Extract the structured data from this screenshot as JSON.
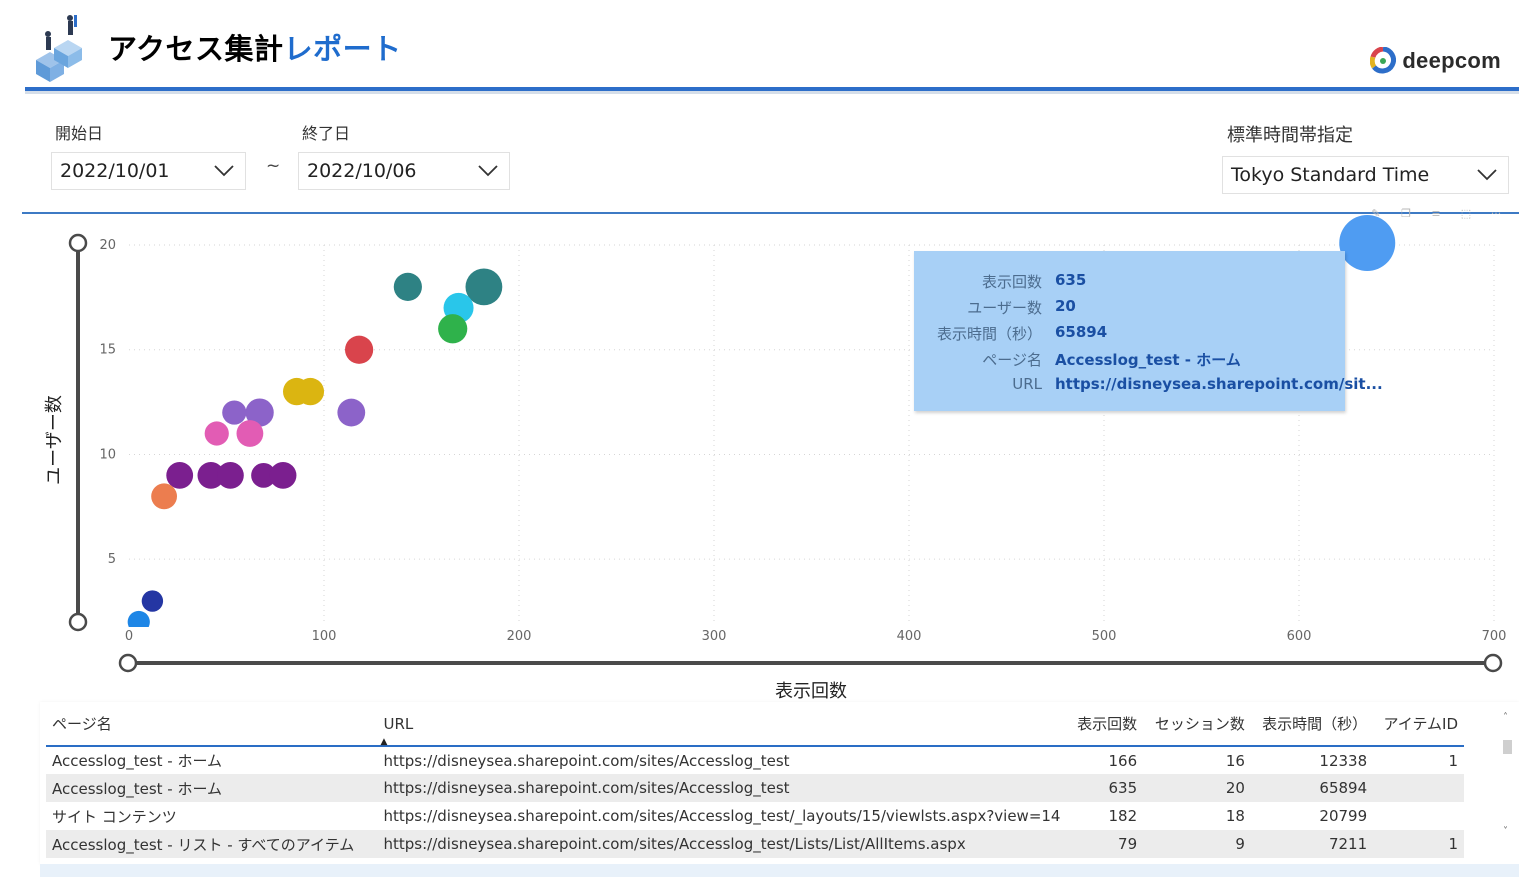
{
  "header": {
    "title_main": "アクセス集計",
    "title_accent": "レポート",
    "brand_name": "deepcom",
    "colors": {
      "accent": "#1f6ccd",
      "rule": "#2d6ec9"
    }
  },
  "filters": {
    "start_label": "開始日",
    "start_value": "2022/10/01",
    "separator": "~",
    "end_label": "終了日",
    "end_value": "2022/10/06",
    "tz_label": "標準時間帯指定",
    "tz_value": "Tokyo Standard Time"
  },
  "visual_icons": [
    "pin-icon",
    "copy-icon",
    "filter-icon",
    "focus-mode-icon",
    "more-options-icon"
  ],
  "chart_data": {
    "type": "scatter",
    "xlabel": "表示回数",
    "ylabel": "ユーザー数",
    "xlim": [
      0,
      700
    ],
    "ylim": [
      2,
      20
    ],
    "x_ticks": [
      0,
      100,
      200,
      300,
      400,
      500,
      600,
      700
    ],
    "y_ticks": [
      5,
      10,
      15,
      20
    ],
    "grid": true,
    "size_measure": "表示時間（秒）",
    "points": [
      {
        "x": 635,
        "y": 20,
        "size": 65894,
        "color": "#4f9cf2"
      },
      {
        "x": 182,
        "y": 18,
        "size": 20799,
        "color": "#2e8284"
      },
      {
        "x": 143,
        "y": 18,
        "size": 9000,
        "color": "#2e8284"
      },
      {
        "x": 169,
        "y": 17,
        "size": 11000,
        "color": "#29c6ea"
      },
      {
        "x": 166,
        "y": 16,
        "size": 10000,
        "color": "#2fb24b"
      },
      {
        "x": 118,
        "y": 15,
        "size": 9000,
        "color": "#d9444c"
      },
      {
        "x": 86,
        "y": 13,
        "size": 8000,
        "color": "#dbb511"
      },
      {
        "x": 93,
        "y": 13,
        "size": 8000,
        "color": "#dbb511"
      },
      {
        "x": 114,
        "y": 12,
        "size": 8500,
        "color": "#8c63c9"
      },
      {
        "x": 54,
        "y": 12,
        "size": 5000,
        "color": "#8c63c9"
      },
      {
        "x": 67,
        "y": 12,
        "size": 9000,
        "color": "#8c63c9"
      },
      {
        "x": 45,
        "y": 11,
        "size": 5000,
        "color": "#e25cb4"
      },
      {
        "x": 62,
        "y": 11,
        "size": 7500,
        "color": "#e25cb4"
      },
      {
        "x": 26,
        "y": 9,
        "size": 7500,
        "color": "#7b1f8f"
      },
      {
        "x": 42,
        "y": 9,
        "size": 7500,
        "color": "#7b1f8f"
      },
      {
        "x": 52,
        "y": 9,
        "size": 7500,
        "color": "#7b1f8f"
      },
      {
        "x": 69,
        "y": 9,
        "size": 5500,
        "color": "#7b1f8f"
      },
      {
        "x": 79,
        "y": 9,
        "size": 7500,
        "color": "#7b1f8f"
      },
      {
        "x": 18,
        "y": 8,
        "size": 6500,
        "color": "#ec7d4f"
      },
      {
        "x": 12,
        "y": 3,
        "size": 3000,
        "color": "#2436a3"
      },
      {
        "x": 5,
        "y": 2,
        "size": 3500,
        "color": "#1e86e6"
      }
    ]
  },
  "tooltip": {
    "rows": [
      {
        "key": "表示回数",
        "value": "635"
      },
      {
        "key": "ユーザー数",
        "value": "20"
      },
      {
        "key": "表示時間（秒）",
        "value": "65894"
      },
      {
        "key": "ページ名",
        "value": "Accesslog_test - ホーム"
      },
      {
        "key": "URL",
        "value": "https://disneysea.sharepoint.com/sit..."
      }
    ]
  },
  "table": {
    "columns": [
      "ページ名",
      "URL",
      "表示回数",
      "セッション数",
      "表示時間（秒）",
      "アイテムID"
    ],
    "sort_indicator": "▲",
    "rows": [
      [
        "Accesslog_test - ホーム",
        "https://disneysea.sharepoint.com/sites/Accesslog_test",
        "166",
        "16",
        "12338",
        "1"
      ],
      [
        "Accesslog_test - ホーム",
        "https://disneysea.sharepoint.com/sites/Accesslog_test",
        "635",
        "20",
        "65894",
        ""
      ],
      [
        "サイト コンテンツ",
        "https://disneysea.sharepoint.com/sites/Accesslog_test/_layouts/15/viewlsts.aspx?view=14",
        "182",
        "18",
        "20799",
        ""
      ],
      [
        "Accesslog_test - リスト - すべてのアイテム",
        "https://disneysea.sharepoint.com/sites/Accesslog_test/Lists/List/AllItems.aspx",
        "79",
        "9",
        "7211",
        "1"
      ]
    ],
    "scroll_up": "˄",
    "scroll_down": "˅"
  }
}
